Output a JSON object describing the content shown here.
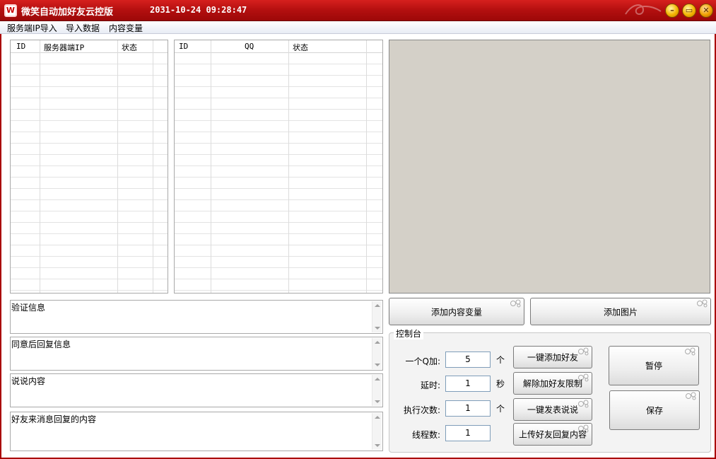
{
  "window": {
    "title": "微笑自动加好友云控版",
    "clock": "2031-10-24 09:28:47",
    "logo_letter": "W"
  },
  "menu": [
    "服务端IP导入",
    "导入数据",
    "内容变量"
  ],
  "server_grid": {
    "columns": [
      "ID",
      "服务器端IP",
      "状态"
    ]
  },
  "qq_grid": {
    "columns": [
      "ID",
      "QQ",
      "状态"
    ]
  },
  "buttons": {
    "add_content_var": "添加内容变量",
    "add_image": "添加图片",
    "one_click_add_friend": "一键添加好友",
    "remove_limit": "解除加好友限制",
    "one_click_post": "一键发表说说",
    "upload_reply": "上传好友回复内容",
    "pause": "暂停",
    "save": "保存"
  },
  "textareas": {
    "verify_info": "验证信息",
    "reply_after_accept": "同意后回复信息",
    "post_content": "说说内容",
    "friend_msg_reply": "好友来消息回复的内容"
  },
  "console": {
    "legend": "控制台",
    "per_q_label": "一个Q加:",
    "per_q_value": "5",
    "per_q_unit": "个",
    "delay_label": "延时:",
    "delay_value": "1",
    "delay_unit": "秒",
    "exec_label": "执行次数:",
    "exec_value": "1",
    "exec_unit": "个",
    "threads_label": "线程数:",
    "threads_value": "1"
  }
}
